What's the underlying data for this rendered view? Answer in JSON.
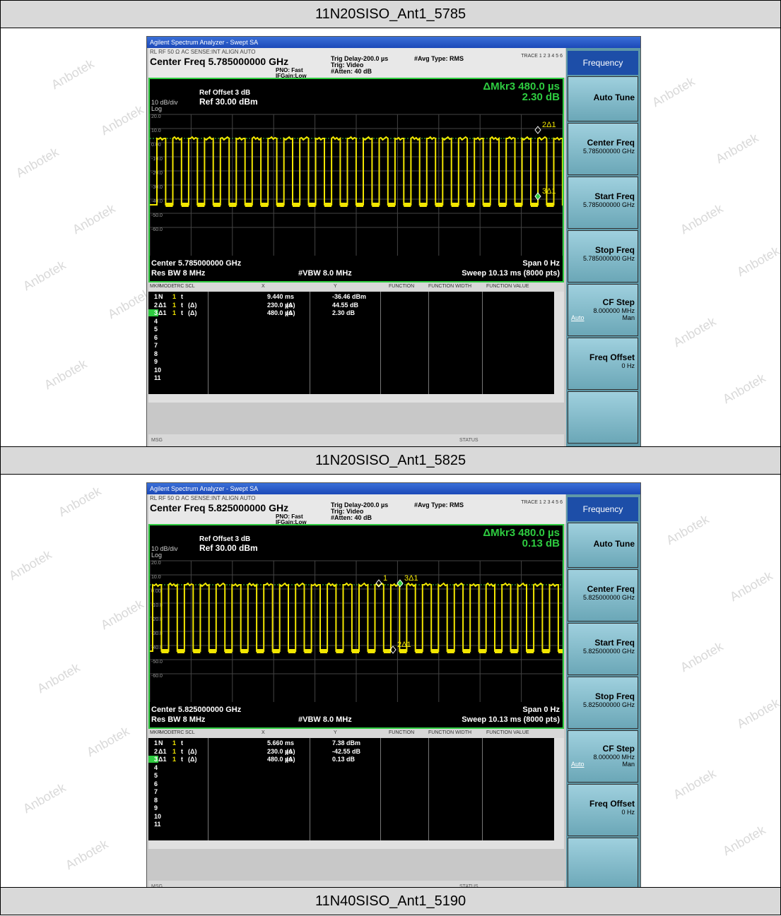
{
  "watermark": "Anbotek",
  "headers": [
    "11N20SISO_Ant1_5785",
    "11N20SISO_Ant1_5825",
    "11N40SISO_Ant1_5190"
  ],
  "colors": {
    "trace": "#f2e600",
    "marker": "#2ecc40",
    "screen_bg": "#000000",
    "softkey": "#7fb8c8"
  },
  "analyzers": [
    {
      "window_title": "Agilent Spectrum Analyzer - Swept SA",
      "status_row": "RL     RF   50 Ω  AC            SENSE:INT              ALIGN AUTO",
      "center_freq_title": "Center Freq 5.785000000 GHz",
      "pno": "PNO: Fast",
      "ifgain": "IFGain:Low",
      "trig_delay": "Trig Delay-200.0 µs",
      "trig": "Trig: Video",
      "atten": "#Atten: 40 dB",
      "avg_type": "#Avg Type: RMS",
      "trace_info": "TRACE 1 2 3 4 5 6",
      "ref_offset": "Ref Offset 3 dB",
      "scale": "10 dB/div",
      "ref_level": "Ref 30.00 dBm",
      "log": "Log",
      "marker_readout": "ΔMkr3 480.0 µs",
      "marker_value": "2.30 dB",
      "y_ticks": [
        "20.0",
        "10.0",
        "0.00",
        "-10.0",
        "-20.0",
        "-30.0",
        "-40.0",
        "-50.0",
        "-60.0"
      ],
      "center": "Center 5.785000000 GHz",
      "span": "Span 0 Hz",
      "res_bw": "Res BW 8 MHz",
      "vbw": "#VBW 8.0 MHz",
      "sweep": "Sweep  10.13 ms (8000 pts)",
      "marker_labels": [
        "2Δ1",
        "3Δ1"
      ],
      "table_headers": [
        "MKR",
        "MODE",
        "TRC",
        "SCL",
        "X",
        "Y",
        "FUNCTION",
        "FUNCTION WIDTH",
        "FUNCTION VALUE"
      ],
      "table_rows": [
        {
          "n": "1",
          "mode": "N",
          "trc": "1",
          "scl": "t",
          "delta": "",
          "x": "9.440 ms",
          "d2": "",
          "y": "-36.46 dBm"
        },
        {
          "n": "2",
          "mode": "Δ1",
          "trc": "1",
          "scl": "t",
          "delta": "(Δ)",
          "x": "230.0 µs",
          "d2": "(Δ)",
          "y": "44.55 dB"
        },
        {
          "n": "3",
          "mode": "Δ1",
          "trc": "1",
          "scl": "t",
          "delta": "(Δ)",
          "x": "480.0 µs",
          "d2": "(Δ)",
          "y": "2.30 dB"
        }
      ],
      "empty_rows": [
        "4",
        "5",
        "6",
        "7",
        "8",
        "9",
        "10",
        "11"
      ],
      "msg": "MSG",
      "status": "STATUS",
      "softkeys": {
        "menu": "Frequency",
        "auto_tune": "Auto Tune",
        "center_freq": "Center Freq",
        "center_val": "5.785000000 GHz",
        "start_freq": "Start Freq",
        "start_val": "5.785000000 GHz",
        "stop_freq": "Stop Freq",
        "stop_val": "5.785000000 GHz",
        "cf_step": "CF Step",
        "cf_val": "8.000000 MHz",
        "auto": "Auto",
        "man": "Man",
        "freq_offset": "Freq Offset",
        "offset_val": "0 Hz"
      }
    },
    {
      "window_title": "Agilent Spectrum Analyzer - Swept SA",
      "status_row": "RL     RF   50 Ω  AC            SENSE:INT              ALIGN AUTO",
      "center_freq_title": "Center Freq 5.825000000 GHz",
      "pno": "PNO: Fast",
      "ifgain": "IFGain:Low",
      "trig_delay": "Trig Delay-200.0 µs",
      "trig": "Trig: Video",
      "atten": "#Atten: 40 dB",
      "avg_type": "#Avg Type: RMS",
      "trace_info": "TRACE 1 2 3 4 5 6",
      "ref_offset": "Ref Offset 3 dB",
      "scale": "10 dB/div",
      "ref_level": "Ref 30.00 dBm",
      "log": "Log",
      "marker_readout": "ΔMkr3 480.0 µs",
      "marker_value": "0.13 dB",
      "y_ticks": [
        "20.0",
        "10.0",
        "0.00",
        "-10.0",
        "-20.0",
        "-30.0",
        "-40.0",
        "-50.0",
        "-60.0"
      ],
      "center": "Center 5.825000000 GHz",
      "span": "Span 0 Hz",
      "res_bw": "Res BW 8 MHz",
      "vbw": "#VBW 8.0 MHz",
      "sweep": "Sweep  10.13 ms (8000 pts)",
      "marker_labels": [
        "1",
        "3Δ1",
        "2Δ1"
      ],
      "table_headers": [
        "MKR",
        "MODE",
        "TRC",
        "SCL",
        "X",
        "Y",
        "FUNCTION",
        "FUNCTION WIDTH",
        "FUNCTION VALUE"
      ],
      "table_rows": [
        {
          "n": "1",
          "mode": "N",
          "trc": "1",
          "scl": "t",
          "delta": "",
          "x": "5.660 ms",
          "d2": "",
          "y": "7.38 dBm"
        },
        {
          "n": "2",
          "mode": "Δ1",
          "trc": "1",
          "scl": "t",
          "delta": "(Δ)",
          "x": "230.0 µs",
          "d2": "(Δ)",
          "y": "-42.55 dB"
        },
        {
          "n": "3",
          "mode": "Δ1",
          "trc": "1",
          "scl": "t",
          "delta": "(Δ)",
          "x": "480.0 µs",
          "d2": "(Δ)",
          "y": "0.13 dB"
        }
      ],
      "empty_rows": [
        "4",
        "5",
        "6",
        "7",
        "8",
        "9",
        "10",
        "11"
      ],
      "msg": "MSG",
      "status": "STATUS",
      "softkeys": {
        "menu": "Frequency",
        "auto_tune": "Auto Tune",
        "center_freq": "Center Freq",
        "center_val": "5.825000000 GHz",
        "start_freq": "Start Freq",
        "start_val": "5.825000000 GHz",
        "stop_freq": "Stop Freq",
        "stop_val": "5.825000000 GHz",
        "cf_step": "CF Step",
        "cf_val": "8.000000 MHz",
        "auto": "Auto",
        "man": "Man",
        "freq_offset": "Freq Offset",
        "offset_val": "0 Hz"
      }
    }
  ]
}
